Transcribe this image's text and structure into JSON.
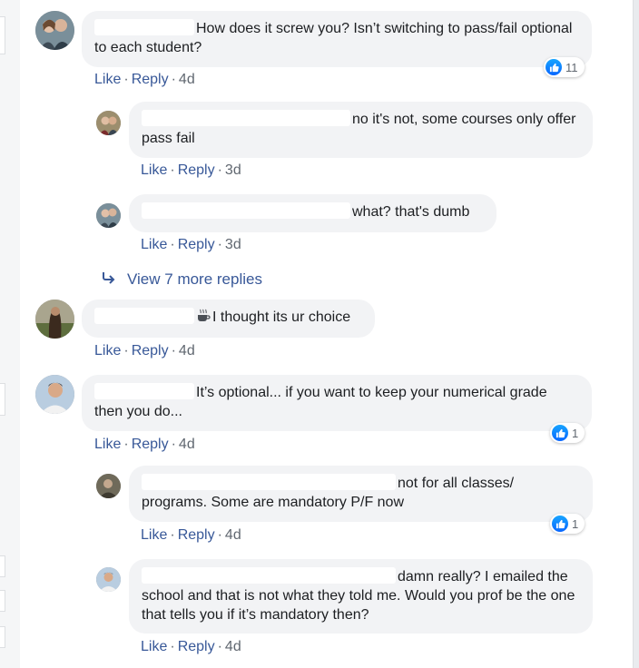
{
  "actions": {
    "like": "Like",
    "reply": "Reply",
    "separator": "·"
  },
  "comments": [
    {
      "text": "How does it screw you? Isn’t switching to pass/fail optional to each student?",
      "time": "4d",
      "reactions": "11"
    },
    {
      "text": "no it's not, some courses only offer pass fail",
      "time": "3d"
    },
    {
      "text": "what? that's dumb",
      "time": "3d"
    },
    {
      "text": "I thought its ur choice",
      "time": "4d"
    },
    {
      "text": "It’s optional... if you want to keep your numerical grade then you do...",
      "time": "4d",
      "reactions": "1"
    },
    {
      "text": "not for all classes/ programs. Some are mandatory P/F now",
      "time": "4d",
      "reactions": "1"
    },
    {
      "text": "damn really? I emailed the school and that is not what they told me. Would you prof be the one that tells you if it’s mandatory then?",
      "time": "4d"
    }
  ],
  "view_more": {
    "label": "View 7 more replies"
  },
  "icons": {
    "like_icon": "like-icon",
    "reply_arrow": "reply-arrow-icon",
    "coffee": "coffee-icon"
  },
  "colors": {
    "link": "#385898",
    "bubble": "#f2f3f5",
    "like_blue": "#0866ff"
  }
}
